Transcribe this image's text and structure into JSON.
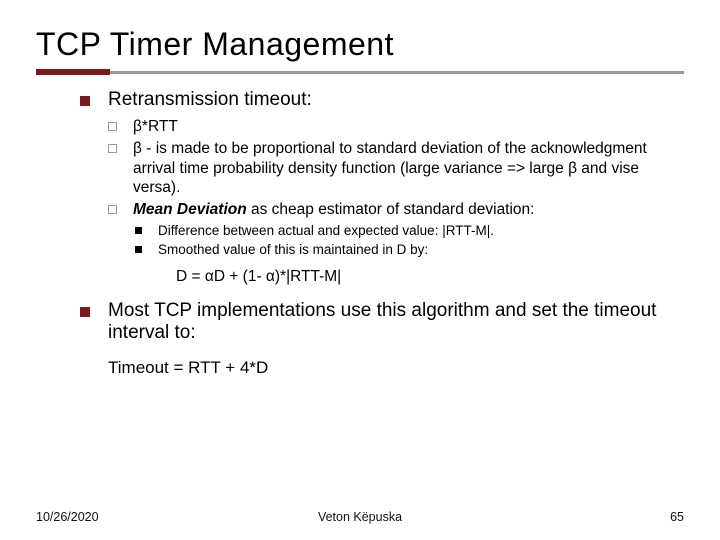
{
  "title": "TCP Timer Management",
  "b1": {
    "i0": "Retransmission timeout:",
    "i1": "Most TCP implementations use this algorithm and set the timeout interval to:"
  },
  "b2": {
    "i0": "β*RTT",
    "i1": "β - is made to be proportional to standard deviation of the acknowledgment arrival time probability density function (large variance => large β and vise versa).",
    "i2_pre": "Mean Deviation",
    "i2_post": " as cheap estimator of standard deviation:"
  },
  "b3": {
    "i0": "Difference between actual and expected value: |RTT-M|.",
    "i1": "Smoothed value of this is maintained in D by:"
  },
  "formula1": "D = αD + (1- α)*|RTT-M|",
  "formula2": "Timeout = RTT + 4*D",
  "footer": {
    "left": "10/26/2020",
    "center": "Veton Këpuska",
    "right": "65"
  }
}
